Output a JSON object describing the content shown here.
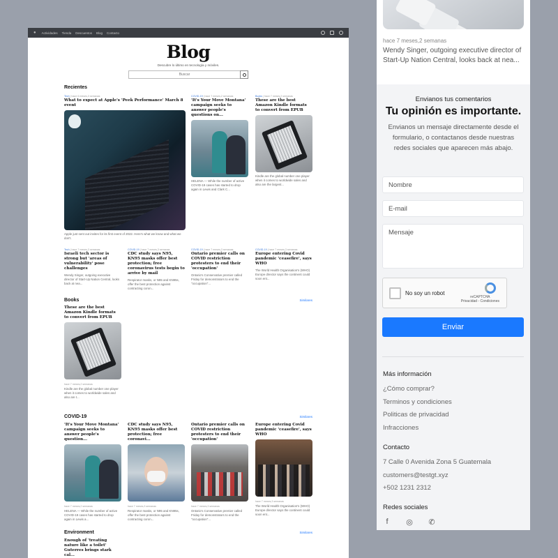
{
  "nav": {
    "apple_icon": "apple-logo",
    "links": [
      "Actividades",
      "Tienda",
      "Descuentos",
      "Blog",
      "Contacto"
    ],
    "icons": [
      "search-icon",
      "bag-icon",
      "user-icon"
    ]
  },
  "hero": {
    "title": "Blog",
    "subtitle": "Descubre lo último en tecnología y móviles.",
    "search_placeholder": "Buscar"
  },
  "recent": {
    "title": "Recientes",
    "featured": {
      "meta_tag": "Tech",
      "meta_time": " | hace 6 meses,3 semanas",
      "headline": "What to expect at Apple's 'Peek Performance' March 8 event",
      "excerpt": "Apple just sent out invites for its first event of 2022. Here's what we know and what we don't."
    },
    "side": [
      {
        "tag": "COVID-19",
        "time": " | hace 7 meses,2 semanas",
        "headline": "'It's Your Move Montana' campaign seeks to answer people's questions on...",
        "excerpt": "HELENA — While the number of active COVID-19 cases has started to drop again in Lewis and Clark C..."
      },
      {
        "tag": "Books",
        "time": " | hace 7 meses,2 semanas",
        "headline": "These are the best Amazon Kindle formats to convert from EPUB",
        "excerpt": "Kindle are the global number one player when it comes to worldwide sales and also are the largest..."
      }
    ],
    "row": [
      {
        "tag": "Tech",
        "time": " | hace 7 meses,3 semanas",
        "headline": "Israeli tech sector is strong but 'areas of vulnerability' pose challenges",
        "excerpt": "Wendy Singer, outgoing executive director of Start-Up Nation Central, looks back at nea..."
      },
      {
        "tag": "COVID-19",
        "time": " | hace 7 meses,3 semanas",
        "headline": "CDC study says N95, KN95 masks offer best protection; free coronavirus tests begin to arrive by mail",
        "excerpt": "Respirator masks, or N95 and KN95s, offer the best protection against contracting coron..."
      },
      {
        "tag": "COVID-19",
        "time": " | hace 7 meses,3 semanas",
        "headline": "Ontario premier calls on COVID restriction protesters to end their 'occupation'",
        "excerpt": "Ontario's Conservative premier called Friday for demonstrators to end the \"occupation\"..."
      },
      {
        "tag": "COVID-19",
        "time": " | hace 7 meses,3 semanas",
        "headline": "Europe entering Covid pandemic 'ceasefire', says WHO",
        "excerpt": "The World Health Organisation's (WHO) Europe director says the continent could soon ent..."
      }
    ]
  },
  "books": {
    "title": "Books",
    "link": "Similares",
    "card": {
      "headline": "These are the best Amazon Kindle formats to convert from EPUB",
      "meta": "hace 7 meses,2 semanas",
      "excerpt": "Kindle are the global number one player when it comes to worldwide sales and also are t..."
    }
  },
  "covid": {
    "title": "COVID-19",
    "link": "Similares",
    "cards": [
      {
        "headline": "'It's Your Move Montana' campaign seeks to answer people's question...",
        "meta": "hace 7 meses,2 semanas",
        "excerpt": "HELENA — While the number of active COVID-19 cases has started to drop again in Lewis a..."
      },
      {
        "headline": "CDC study says N95, KN95 masks offer best protection; free coronavi...",
        "meta": "hace 7 meses,3 semanas",
        "excerpt": "Respirator masks, or N95 and KN95s, offer the best protection against contracting coron..."
      },
      {
        "headline": "Ontario premier calls on COVID restriction protesters to end their 'occupation'",
        "meta": "hace 7 meses,3 semanas",
        "excerpt": "Ontario's Conservative premier called Friday for demonstrators to end the \"occupation\"..."
      },
      {
        "headline": "Europe entering Covid pandemic 'ceasefire', says WHO",
        "meta": "hace 7 meses,3 semanas",
        "excerpt": "The World Health Organisation's (WHO) Europe director says the continent could soon ent..."
      }
    ]
  },
  "environment": {
    "title": "Environment",
    "link": "Similares",
    "card": {
      "headline": "Enough of 'treating nature like a toilet' Guterres brings stark cal..."
    }
  },
  "mobile": {
    "meta": "hace 7 meses,2 semanas",
    "excerpt": "Wendy Singer, outgoing executive director of Start-Up Nation Central, looks back at nea...",
    "form": {
      "kicker": "Envianos tus comentarios",
      "heading": "Tu opinión es importante.",
      "description": "Envianos un mensaje directamente desde el formulario, o contactanos desde nuestras redes sociales que aparecen más abajo.",
      "name_placeholder": "Nombre",
      "email_placeholder": "E-mail",
      "message_placeholder": "Mensaje",
      "captcha_label": "No soy un robot",
      "captcha_brand": "reCAPTCHA",
      "captcha_links": "Privacidad - Condiciones",
      "submit": "Enviar"
    },
    "more_info": {
      "title": "Más información",
      "links": [
        "¿Cómo comprar?",
        "Terminos y condiciones",
        "Politicas de privacidad",
        "Infracciones"
      ]
    },
    "contact": {
      "title": "Contacto",
      "lines": [
        "7 Calle 0 Avenida Zona 5 Guatemala",
        "customers@testgt.xyz",
        "+502 1231 2312"
      ]
    },
    "social": {
      "title": "Redes sociales",
      "icons": [
        "facebook-icon",
        "instagram-icon",
        "whatsapp-icon"
      ]
    }
  },
  "colors": {
    "accent": "#1a79ff",
    "navbar": "#3a3d42",
    "background": "#9aa0ab"
  }
}
